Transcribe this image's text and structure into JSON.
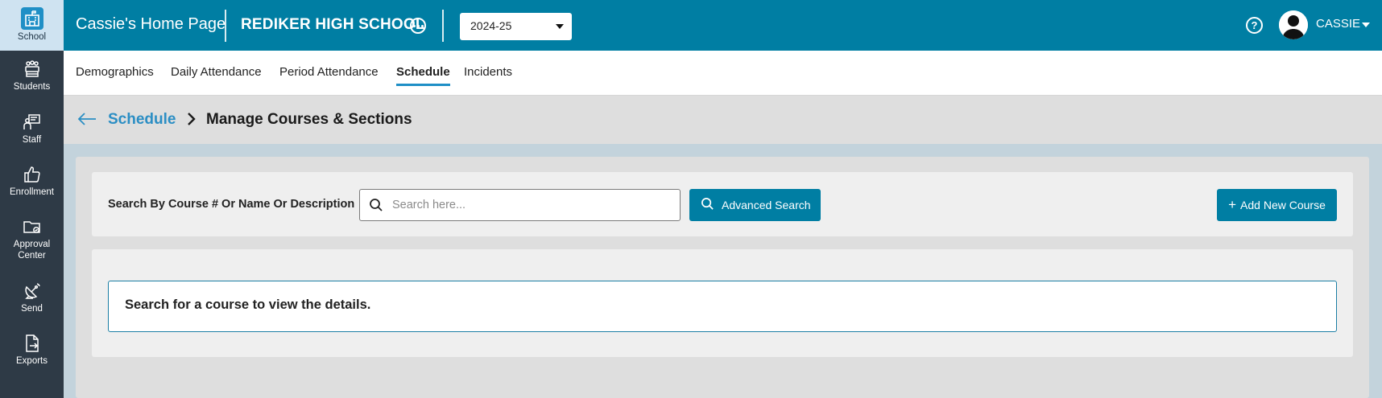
{
  "rail": {
    "items": [
      {
        "label": "School",
        "icon": "school-icon",
        "active": true
      },
      {
        "label": "Students",
        "icon": "students-icon"
      },
      {
        "label": "Staff",
        "icon": "staff-icon"
      },
      {
        "label": "Enrollment",
        "icon": "thumbs-up-icon"
      },
      {
        "label": "Approval\nCenter",
        "icon": "folder-approval-icon"
      },
      {
        "label": "Send",
        "icon": "satellite-dish-icon"
      },
      {
        "label": "Exports",
        "icon": "file-export-icon"
      }
    ]
  },
  "header": {
    "home_title": "Cassie's Home Page",
    "school_name": "REDIKER HIGH SCHOOL",
    "year": "2024-25",
    "user_name": "CASSIE",
    "help_glyph": "?"
  },
  "tabs": [
    {
      "label": "Demographics"
    },
    {
      "label": "Daily Attendance"
    },
    {
      "label": "Period Attendance"
    },
    {
      "label": "Schedule",
      "active": true
    },
    {
      "label": "Incidents"
    }
  ],
  "breadcrumb": {
    "parent": "Schedule",
    "current": "Manage Courses & Sections"
  },
  "search": {
    "label": "Search By Course # Or Name Or Description",
    "placeholder": "Search here...",
    "value": "",
    "advanced_label": "Advanced Search",
    "add_label": "Add New Course",
    "add_glyph": "+"
  },
  "results": {
    "message": "Search for a course to view the details."
  },
  "colors": {
    "brand": "#007ea3",
    "rail": "#2e3a46",
    "link": "#2b8ec4"
  }
}
